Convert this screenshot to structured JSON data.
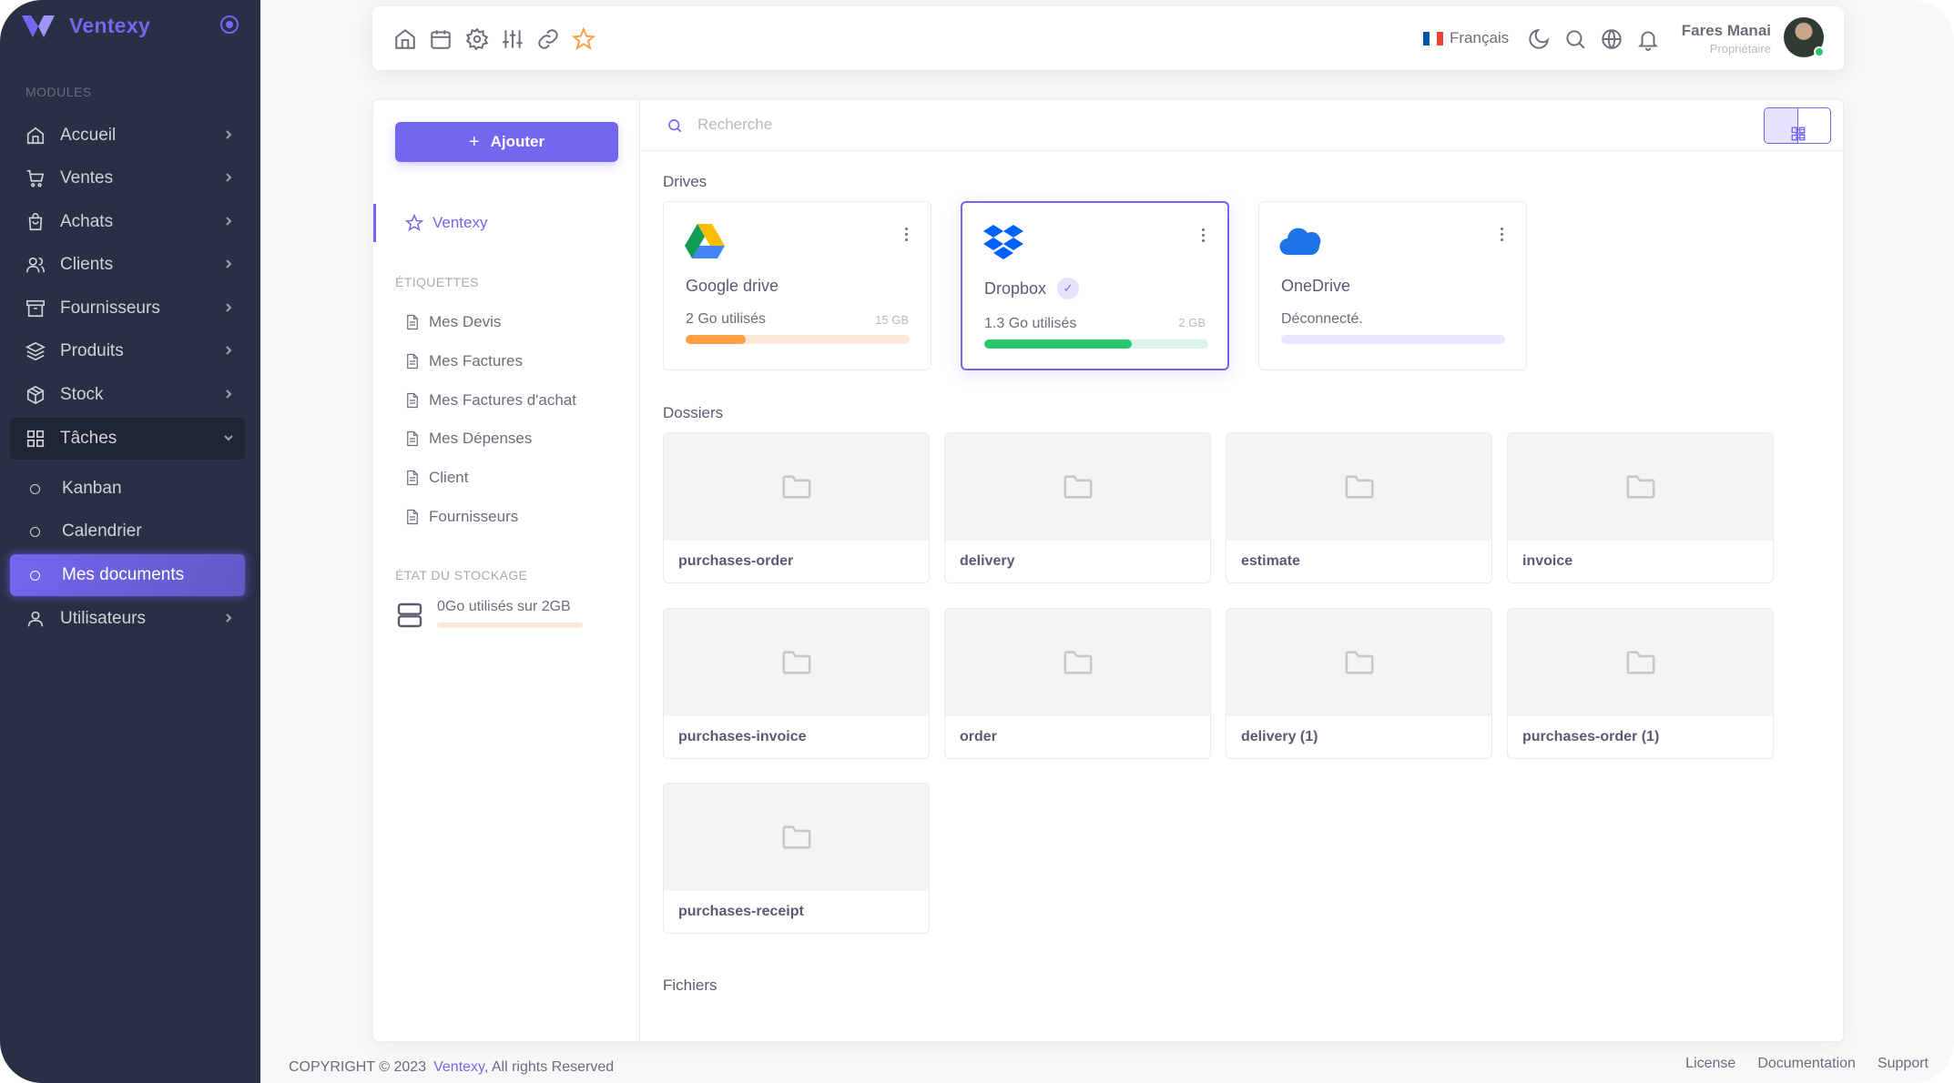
{
  "app": {
    "name": "Ventexy"
  },
  "sidebar": {
    "section_title": "MODULES",
    "items": [
      {
        "label": "Accueil",
        "icon": "home-icon"
      },
      {
        "label": "Ventes",
        "icon": "cart-icon"
      },
      {
        "label": "Achats",
        "icon": "bag-icon"
      },
      {
        "label": "Clients",
        "icon": "users-icon"
      },
      {
        "label": "Fournisseurs",
        "icon": "archive-icon"
      },
      {
        "label": "Produits",
        "icon": "layers-icon"
      },
      {
        "label": "Stock",
        "icon": "box-icon"
      },
      {
        "label": "Tâches",
        "icon": "grid-icon"
      }
    ],
    "sub_items": [
      "Kanban",
      "Calendrier",
      "Mes documents"
    ],
    "last_item": {
      "label": "Utilisateurs",
      "icon": "user-icon"
    }
  },
  "topbar": {
    "language": "Français",
    "user_name": "Fares Manai",
    "user_role": "Propriétaire"
  },
  "file_manager": {
    "add_button": "Ajouter",
    "favorite": "Ventexy",
    "labels_heading": "ÉTIQUETTES",
    "labels": [
      "Mes Devis",
      "Mes Factures",
      "Mes Factures d'achat",
      "Mes Dépenses",
      "Client",
      "Fournisseurs"
    ],
    "storage_heading": "ÉTAT DU STOCKAGE",
    "storage_text": "0Go utilisés sur 2GB",
    "storage_used_fraction": 0.0,
    "search_placeholder": "Recherche",
    "drives_title": "Drives",
    "drives": [
      {
        "name": "Google drive",
        "used": "2 Go utilisés",
        "capacity": "15 GB",
        "fill": 0.27,
        "color": "#ff9f43",
        "track": "#fde9d9"
      },
      {
        "name": "Dropbox",
        "used": "1.3 Go utilisés",
        "capacity": "2 GB",
        "fill": 0.66,
        "color": "#28c76f",
        "track": "#dcf5e8",
        "check": "✓"
      },
      {
        "name": "OneDrive",
        "used": "Déconnecté.",
        "capacity": "",
        "fill": 0.0,
        "color": "#7367f0",
        "track": "#eae8fd"
      }
    ],
    "folders_title": "Dossiers",
    "folders": [
      "purchases-order",
      "delivery",
      "estimate",
      "invoice",
      "purchases-invoice",
      "order",
      "delivery (1)",
      "purchases-order (1)",
      "purchases-receipt"
    ],
    "files_title": "Fichiers"
  },
  "footer": {
    "copyright": "COPYRIGHT © 2023",
    "brand": "Ventexy",
    "rights": ", All rights Reserved",
    "links": [
      "License",
      "Documentation",
      "Support"
    ]
  },
  "colors": {
    "primary": "#7367f0",
    "sidebar_bg": "#283046"
  }
}
